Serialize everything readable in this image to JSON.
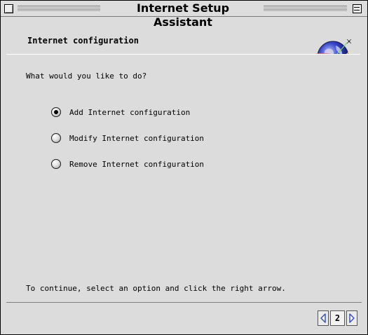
{
  "window": {
    "title": "Internet Setup Assistant"
  },
  "header": {
    "title": "Internet configuration",
    "icon": "globe-icon"
  },
  "main": {
    "prompt": "What would you like to do?",
    "options": [
      {
        "label": "Add Internet configuration",
        "selected": true
      },
      {
        "label": "Modify Internet configuration",
        "selected": false
      },
      {
        "label": "Remove Internet configuration",
        "selected": false
      }
    ],
    "instruction": "To continue, select an option and click the right arrow."
  },
  "navigation": {
    "page_number": "2",
    "prev_icon": "left-arrow-icon",
    "next_icon": "right-arrow-icon"
  },
  "colors": {
    "arrow": "#3b4fc4",
    "window_bg": "#dcdcdc"
  }
}
